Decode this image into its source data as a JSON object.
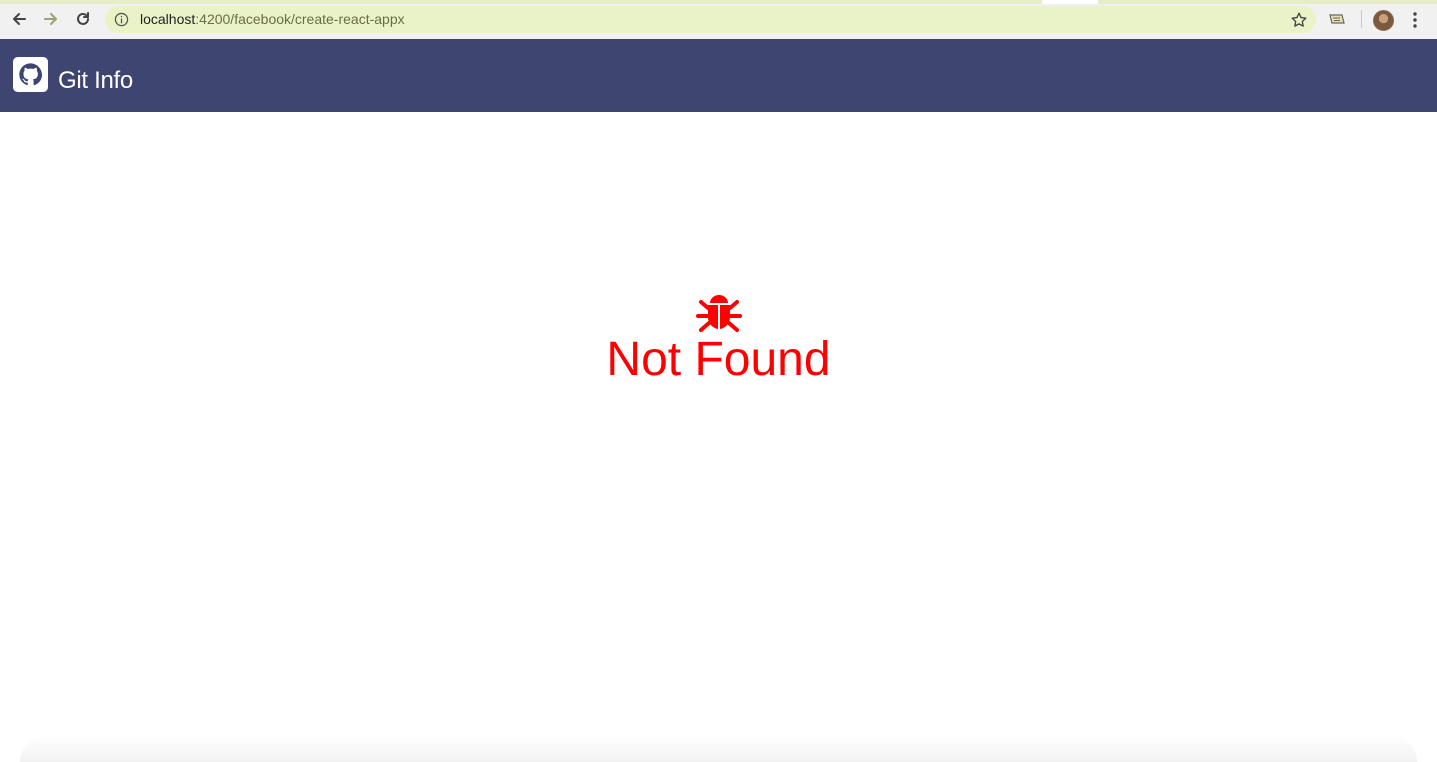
{
  "browser": {
    "url_host": "localhost",
    "url_path": ":4200/facebook/create-react-appx",
    "icons": {
      "back": "back-arrow-icon",
      "forward": "forward-arrow-icon",
      "reload": "reload-icon",
      "info": "info-icon",
      "bookmark": "star-icon",
      "extension": "extension-icon",
      "profile": "avatar",
      "menu": "kebab-menu-icon"
    }
  },
  "header": {
    "title": "Git Info",
    "logo_icon": "github-icon",
    "background_color": "#3f4571"
  },
  "main": {
    "error_icon": "bug-icon",
    "message": "Not Found",
    "error_color": "#ff0000"
  }
}
